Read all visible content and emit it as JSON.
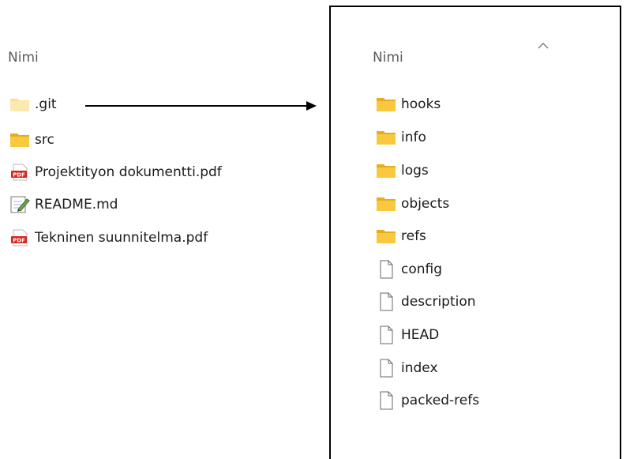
{
  "left_pane": {
    "column_header": "Nimi",
    "items": [
      {
        "name": ".git",
        "icon": "folder-icon"
      },
      {
        "name": "src",
        "icon": "folder-icon"
      },
      {
        "name": "Projektityon dokumentti.pdf",
        "icon": "pdf-icon"
      },
      {
        "name": "README.md",
        "icon": "notepad-icon"
      },
      {
        "name": "Tekninen suunnitelma.pdf",
        "icon": "pdf-icon"
      }
    ]
  },
  "right_pane": {
    "column_header": "Nimi",
    "sort_indicator": "chevron-up-icon",
    "items": [
      {
        "name": "hooks",
        "icon": "folder-icon"
      },
      {
        "name": "info",
        "icon": "folder-icon"
      },
      {
        "name": "logs",
        "icon": "folder-icon"
      },
      {
        "name": "objects",
        "icon": "folder-icon"
      },
      {
        "name": "refs",
        "icon": "folder-icon"
      },
      {
        "name": "config",
        "icon": "file-icon"
      },
      {
        "name": "description",
        "icon": "file-icon"
      },
      {
        "name": "HEAD",
        "icon": "file-icon"
      },
      {
        "name": "index",
        "icon": "file-icon"
      },
      {
        "name": "packed-refs",
        "icon": "file-icon"
      }
    ]
  },
  "colors": {
    "folder": "#f8c93e",
    "folder_dark": "#e6ac1a",
    "pdf_red": "#d9261c",
    "header_text": "#5c5c5c"
  }
}
